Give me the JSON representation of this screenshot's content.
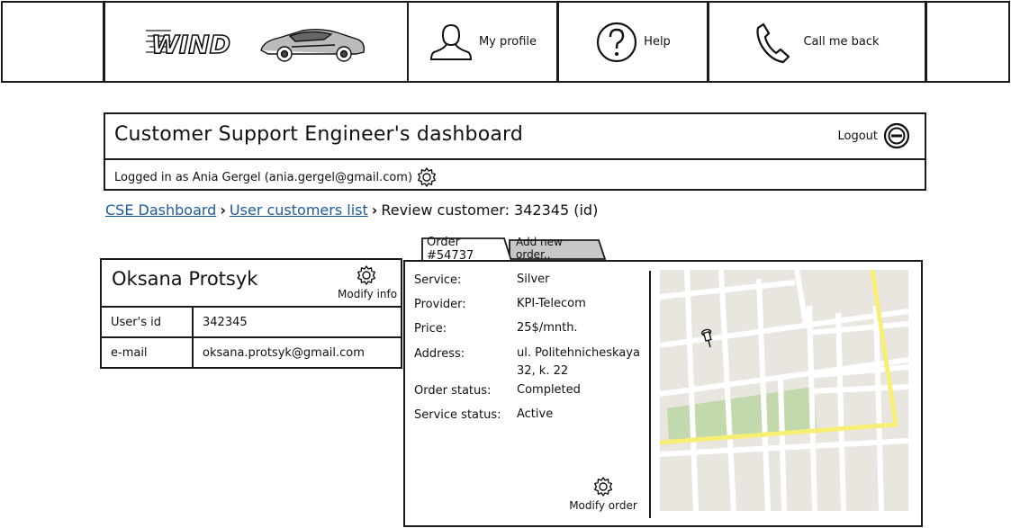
{
  "header": {
    "logo_text": "WIND",
    "nav": [
      {
        "label": "My profile",
        "icon": "user-icon"
      },
      {
        "label": "Help",
        "icon": "help-icon"
      },
      {
        "label": "Call me back",
        "icon": "phone-icon"
      }
    ]
  },
  "dashboard": {
    "title": "Customer Support Engineer's dashboard",
    "logout_label": "Logout",
    "logged_in_text": "Logged in as Ania Gergel (ania.gergel@gmail.com)"
  },
  "breadcrumb": {
    "items": [
      "CSE Dashboard",
      "User customers list"
    ],
    "current": "Review customer: 342345 (id)"
  },
  "customer": {
    "name": "Oksana Protsyk",
    "modify_label": "Modify info",
    "rows": [
      {
        "label": "User's id",
        "value": "342345"
      },
      {
        "label": "e-mail",
        "value": "oksana.protsyk@gmail.com"
      }
    ]
  },
  "order": {
    "tabs": [
      "Order #54737",
      "Add new order.."
    ],
    "details": [
      {
        "label": "Service:",
        "value": "Silver"
      },
      {
        "label": "Provider:",
        "value": "KPI-Telecom"
      },
      {
        "label": "Price:",
        "value": "25$/mnth."
      },
      {
        "label": "Address:",
        "value": "ul. Politehnicheskaya 32, k. 22"
      },
      {
        "label": "Order status:",
        "value": "Completed"
      },
      {
        "label": "Service status:",
        "value": "Active"
      }
    ],
    "modify_label": "Modify order"
  },
  "colors": {
    "link": "#1e5aa0",
    "map_bg": "#e9e6e0",
    "map_road": "#ffffff",
    "map_highway": "#f7ee74",
    "map_park": "#c2d8ad"
  }
}
